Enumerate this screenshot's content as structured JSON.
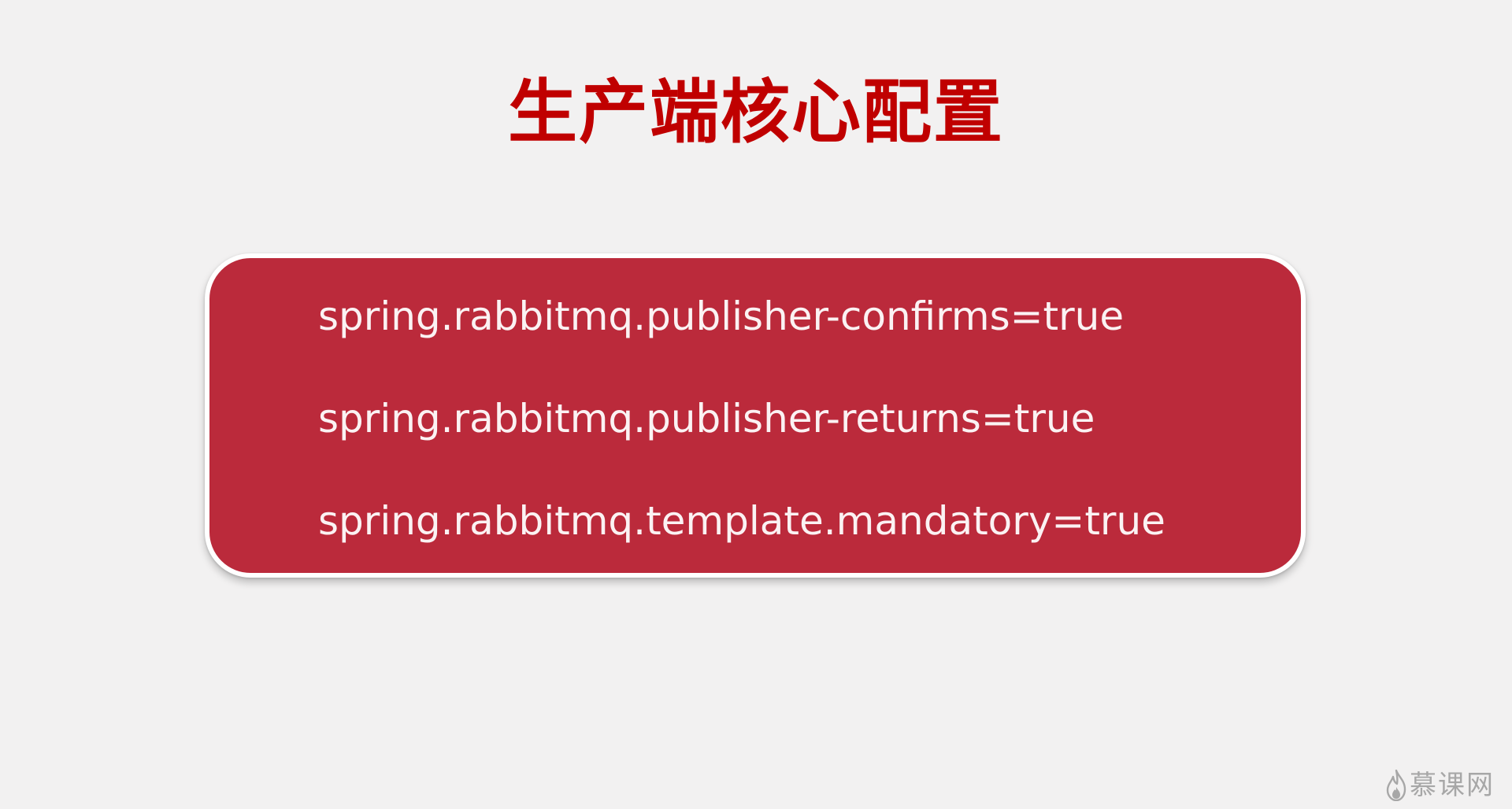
{
  "slide": {
    "title": "生产端核心配置",
    "config_lines": [
      "spring.rabbitmq.publisher-confirms=true",
      "spring.rabbitmq.publisher-returns=true",
      "spring.rabbitmq.template.mandatory=true"
    ]
  },
  "watermark": {
    "text": "慕课网",
    "icon": "flame-logo-icon"
  },
  "colors": {
    "background": "#f2f1f1",
    "title": "#c00000",
    "box_fill": "#bb2a3b",
    "box_border": "#ffffff",
    "box_text": "#fbf2f3",
    "watermark": "#8f8f8f"
  }
}
